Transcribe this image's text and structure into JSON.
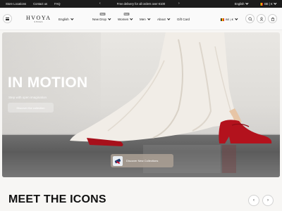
{
  "topbar": {
    "links": [
      "Store Locations",
      "Contact us",
      "FAQ"
    ],
    "promo": "Free delivery for all orders over €100",
    "language": "English",
    "region": "BE | €"
  },
  "header": {
    "logo": {
      "name": "HVOYA",
      "sub": "SHOES"
    },
    "language": "English",
    "nav": [
      {
        "label": "New Drop",
        "badge": "New"
      },
      {
        "label": "Women",
        "badge": "Sale"
      },
      {
        "label": "Men",
        "badge": ""
      },
      {
        "label": "About",
        "badge": ""
      },
      {
        "label": "Gift Card",
        "badge": ""
      }
    ],
    "region": "BE | €"
  },
  "hero": {
    "title": "IN MOTION",
    "subtitle": "Step with open imagination",
    "cta": "Discover the collection",
    "discover": "Discover New Collections"
  },
  "section": {
    "title": "MEET THE ICONS"
  },
  "icons": {
    "menu": "hamburger-icon",
    "search": "search-icon",
    "account": "user-icon",
    "cart": "bag-icon",
    "prev": "chevron-left-icon",
    "next": "chevron-right-icon"
  },
  "colors": {
    "topbar_bg": "#1c1c1c",
    "shoe_red": "#b3121d",
    "dress": "#f1ede7"
  }
}
